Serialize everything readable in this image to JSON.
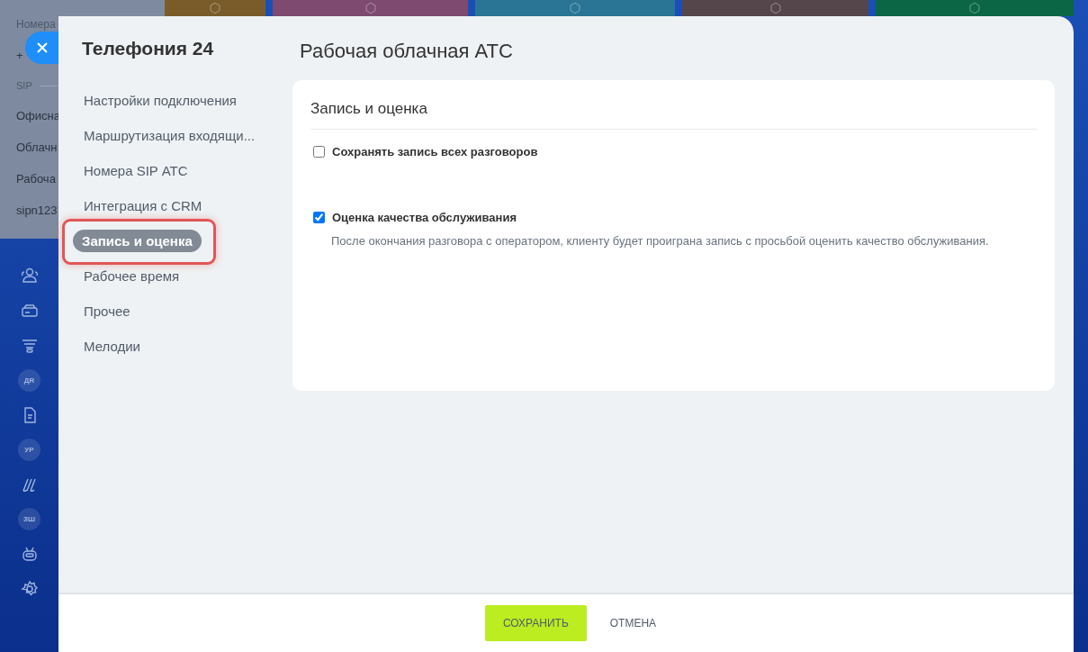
{
  "background": {
    "tiles": [
      {
        "color": "#7a5c2a"
      },
      {
        "color": "#7e4a70"
      },
      {
        "color": "#2a7595"
      },
      {
        "color": "#55464b"
      },
      {
        "color": "#0a6645"
      }
    ],
    "rail": [
      {
        "kind": "people"
      },
      {
        "kind": "drive"
      },
      {
        "kind": "funnel"
      },
      {
        "kind": "avatar",
        "label": "ДR"
      },
      {
        "kind": "document"
      },
      {
        "kind": "avatar",
        "label": "УР"
      },
      {
        "kind": "scribble"
      },
      {
        "kind": "avatar",
        "label": "ЗШ"
      },
      {
        "kind": "robot"
      },
      {
        "kind": "gear"
      }
    ],
    "panel": [
      {
        "kind": "heading",
        "label": "Номера"
      },
      {
        "kind": "item",
        "label": "+"
      },
      {
        "kind": "divider",
        "label": "SIP"
      },
      {
        "kind": "item",
        "label": "Офисна"
      },
      {
        "kind": "item",
        "label": "Облачн"
      },
      {
        "kind": "item",
        "label": "Рабоча"
      },
      {
        "kind": "item",
        "label": "sipn123"
      }
    ]
  },
  "slider": {
    "title": "Телефония 24",
    "nav": [
      {
        "label": "Настройки подключения",
        "selected": false,
        "highlighted": false
      },
      {
        "label": "Маршрутизация входящи...",
        "selected": false,
        "highlighted": false
      },
      {
        "label": "Номера SIP АТС",
        "selected": false,
        "highlighted": false
      },
      {
        "label": "Интеграция с CRM",
        "selected": false,
        "highlighted": false
      },
      {
        "label": "Запись и оценка",
        "selected": true,
        "highlighted": true
      },
      {
        "label": "Рабочее время",
        "selected": false,
        "highlighted": false
      },
      {
        "label": "Прочее",
        "selected": false,
        "highlighted": false
      },
      {
        "label": "Мелодии",
        "selected": false,
        "highlighted": false
      }
    ],
    "header": "Рабочая облачная АТС",
    "section": {
      "title": "Запись и оценка",
      "options": [
        {
          "label": "Сохранять запись всех разговоров",
          "checked": false
        },
        {
          "label": "Оценка качества обслуживания",
          "checked": true,
          "description": "После окончания разговора с оператором, клиенту будет проиграна запись с просьбой оценить качество обслуживания."
        }
      ]
    },
    "buttons": [
      {
        "kind": "primary",
        "label": "СОХРАНИТЬ"
      },
      {
        "kind": "link",
        "label": "ОТМЕНА"
      }
    ]
  }
}
